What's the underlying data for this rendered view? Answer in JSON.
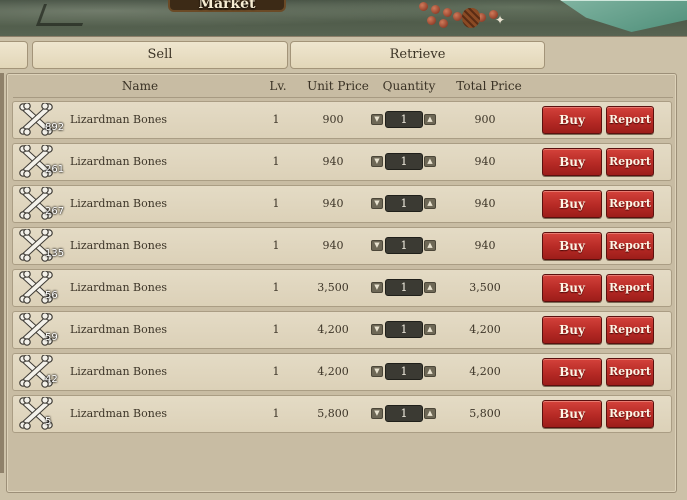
{
  "window": {
    "title": "Market"
  },
  "tabs": [
    {
      "label": ""
    },
    {
      "label": "Sell"
    },
    {
      "label": "Retrieve"
    }
  ],
  "table": {
    "columns": {
      "name": "Name",
      "level": "Lv.",
      "unit_price": "Unit Price",
      "quantity": "Quantity",
      "total_price": "Total Price"
    },
    "buy_label": "Buy",
    "report_label": "Report",
    "rows": [
      {
        "icon": "crossed-bones-icon",
        "stack": "892",
        "name": "Lizardman Bones",
        "level": "1",
        "unit_price": "900",
        "quantity": "1",
        "total_price": "900"
      },
      {
        "icon": "crossed-bones-icon",
        "stack": "261",
        "name": "Lizardman Bones",
        "level": "1",
        "unit_price": "940",
        "quantity": "1",
        "total_price": "940"
      },
      {
        "icon": "crossed-bones-icon",
        "stack": "267",
        "name": "Lizardman Bones",
        "level": "1",
        "unit_price": "940",
        "quantity": "1",
        "total_price": "940"
      },
      {
        "icon": "crossed-bones-icon",
        "stack": "135",
        "name": "Lizardman Bones",
        "level": "1",
        "unit_price": "940",
        "quantity": "1",
        "total_price": "940"
      },
      {
        "icon": "crossed-bones-icon",
        "stack": "56",
        "name": "Lizardman Bones",
        "level": "1",
        "unit_price": "3,500",
        "quantity": "1",
        "total_price": "3,500"
      },
      {
        "icon": "crossed-bones-icon",
        "stack": "59",
        "name": "Lizardman Bones",
        "level": "1",
        "unit_price": "4,200",
        "quantity": "1",
        "total_price": "4,200"
      },
      {
        "icon": "crossed-bones-icon",
        "stack": "42",
        "name": "Lizardman Bones",
        "level": "1",
        "unit_price": "4,200",
        "quantity": "1",
        "total_price": "4,200"
      },
      {
        "icon": "crossed-bones-icon",
        "stack": "5",
        "name": "Lizardman Bones",
        "level": "1",
        "unit_price": "5,800",
        "quantity": "1",
        "total_price": "5,800"
      }
    ]
  },
  "colors": {
    "panel": "#ccc1a8",
    "row": "#e4dbc5",
    "button_red": "#b62a25",
    "text": "#3d3528"
  }
}
